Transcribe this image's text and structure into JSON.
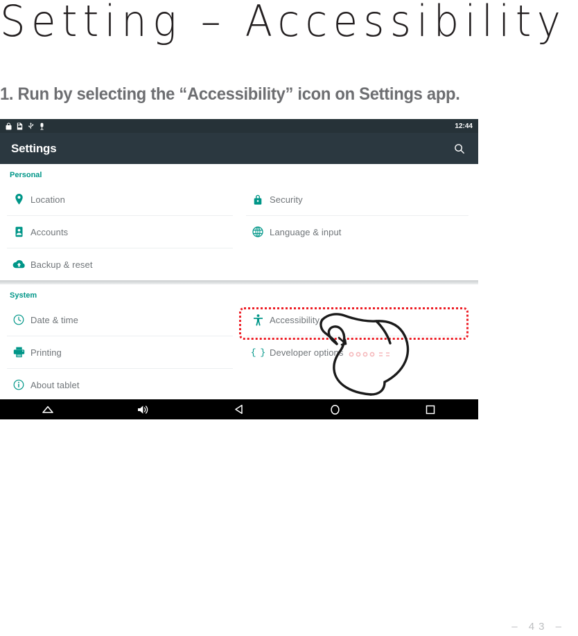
{
  "slide": {
    "title": "Setting – Accessibility",
    "subtitle": "1. Run by selecting the “Accessibility” icon on Settings app.",
    "page_number": "–   43   –",
    "accent_red": "#ed1c24",
    "accent_teal": "#009688"
  },
  "device": {
    "statusbar": {
      "clock": "12:44",
      "icons": [
        "lock-icon",
        "sim-card-icon",
        "usb-icon",
        "microphone-icon"
      ],
      "background": "#263238"
    },
    "actionbar": {
      "title": "Settings",
      "search_icon": "search-icon",
      "background": "#2b3840"
    },
    "sections": [
      {
        "header": "Personal",
        "left_items": [
          {
            "label": "Location",
            "icon": "location-pin-icon"
          },
          {
            "label": "Accounts",
            "icon": "accounts-icon"
          },
          {
            "label": "Backup & reset",
            "icon": "cloud-upload-icon"
          }
        ],
        "right_items": [
          {
            "label": "Security",
            "icon": "lock-icon"
          },
          {
            "label": "Language & input",
            "icon": "globe-icon"
          }
        ]
      },
      {
        "header": "System",
        "left_items": [
          {
            "label": "Date & time",
            "icon": "clock-icon"
          },
          {
            "label": "Printing",
            "icon": "printer-icon"
          },
          {
            "label": "About tablet",
            "icon": "info-icon"
          }
        ],
        "right_items": [
          {
            "label": "Accessibility",
            "icon": "accessibility-person-icon"
          },
          {
            "label": "Developer options",
            "icon": "braces-icon"
          }
        ]
      }
    ],
    "navbar": {
      "buttons": [
        "expand-up-icon",
        "volume-icon",
        "back-icon",
        "home-icon",
        "recents-icon"
      ]
    },
    "annotation": {
      "highlight_target": "Accessibility",
      "pointer": "pointing-hand-illustration"
    }
  }
}
